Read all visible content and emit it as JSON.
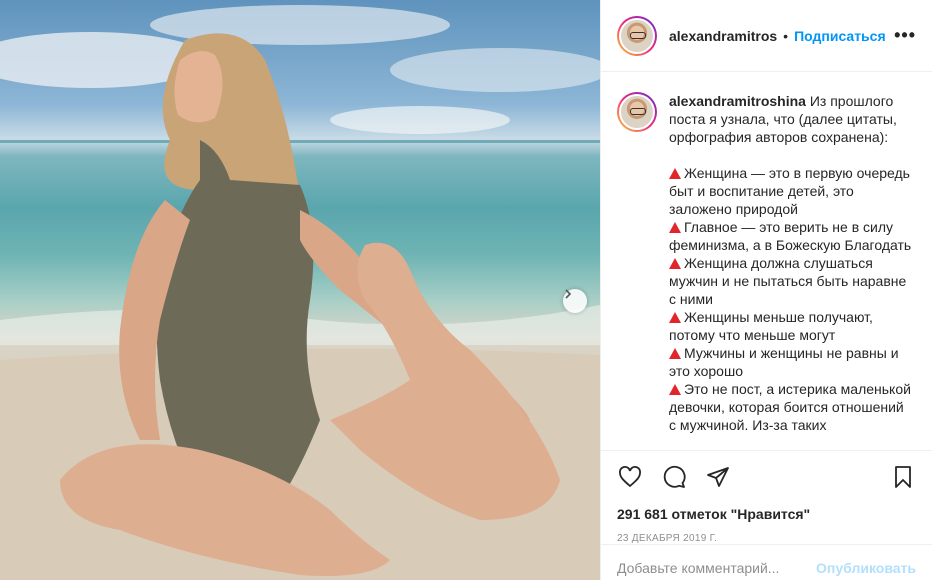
{
  "header": {
    "username": "alexandramitros",
    "separator": "•",
    "follow_label": "Подписаться",
    "more_label": "•••"
  },
  "caption": {
    "username": "alexandramitroshina",
    "intro": "Из прошлого поста я узнала, что (далее цитаты, орфография авторов сохранена):",
    "bullets": [
      "Женщина — это в первую очередь быт и воспитание детей, это заложено природой",
      "Главное — это верить не в силу феминизма, а в Божескую Благодать",
      "Женщина должна слушаться мужчин и не пытаться быть наравне с ними",
      "Женщины меньше получают, потому что меньше могут",
      "Мужчины и женщины не равны и это хорошо",
      "Это не пост, а истерика маленькой девочки, которая боится отношений с мужчиной. Из-за таких"
    ]
  },
  "actions": {
    "like_icon": "heart-icon",
    "comment_icon": "comment-icon",
    "share_icon": "paper-plane-icon",
    "save_icon": "bookmark-icon"
  },
  "likes": "291 681 отметок \"Нравится\"",
  "date": "23 ДЕКАБРЯ 2019 Г.",
  "comment": {
    "placeholder": "Добавьте комментарий...",
    "publish_label": "Опубликовать"
  },
  "colors": {
    "link_blue": "#0095f6",
    "publish_disabled": "#b2dffc",
    "bullet_red": "#e0262a",
    "muted": "#8e8e8e"
  }
}
